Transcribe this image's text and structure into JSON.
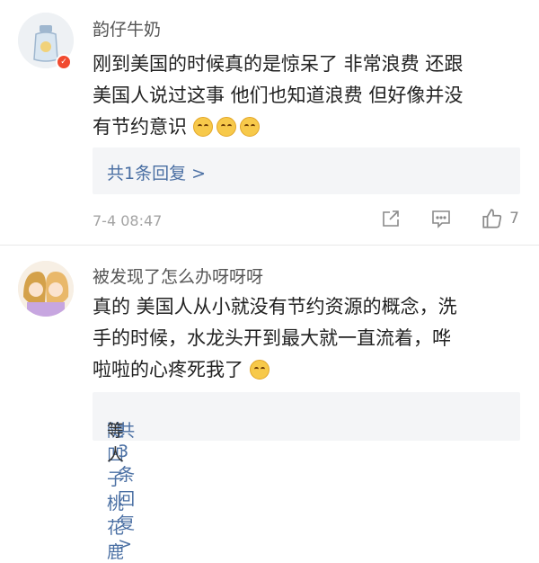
{
  "comments": [
    {
      "username": "韵仔牛奶",
      "content_lines": [
        "刚到美国的时候真的是惊呆了 非常浪费 还跟",
        "美国人说过这事 他们也知道浪费 但好像并没",
        "有节约意识"
      ],
      "replies_label": "共1条回复 >",
      "timestamp": "7-4 08:47",
      "like_count": "7"
    },
    {
      "username": "被发现了怎么办呀呀呀",
      "content_lines": [
        "真的 美国人从小就没有节约资源的概念，洗",
        "手的时候，水龙头开到最大就一直流着，哗",
        "啦啦的心疼死我了"
      ],
      "replies_names": "陡凹子桃花鹿",
      "replies_mid": "等人",
      "replies_label": "共3条回复 >"
    }
  ],
  "icons": {
    "avatar_badge": "v-verified-icon",
    "share": "share-icon",
    "reply": "comment-icon",
    "like": "thumbs-up-icon",
    "emoji_cry_laugh": "laughing-tears-emoji"
  },
  "colors": {
    "link": "#4a6fa3",
    "badge": "#f14a2f"
  }
}
